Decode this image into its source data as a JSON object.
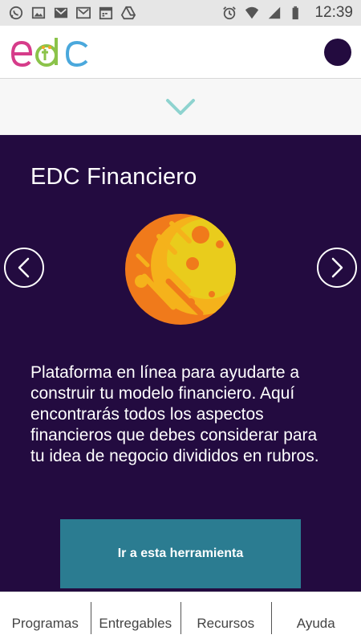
{
  "status_bar": {
    "time": "12:39",
    "left_icons": [
      "whatsapp-icon",
      "image-icon",
      "gmail-icon",
      "gmail-icon",
      "calendar-icon",
      "drive-icon"
    ],
    "right_icons": [
      "alarm-icon",
      "wifi-icon",
      "signal-icon",
      "battery-icon"
    ]
  },
  "header": {
    "logo_text": "EDC",
    "avatar_color": "#230b3f"
  },
  "collapse": {
    "icon": "chevron-down-icon",
    "color": "#8ed3cf"
  },
  "panel": {
    "background": "#230b40",
    "title": "EDC Financiero",
    "description": "Plataforma en línea para ayudarte a construir tu modelo financiero. Aquí encontrarás todos los aspectos financieros que debes considerar para tu idea de negocio divididos en rubros.",
    "cta_label": "Ir a esta herramienta",
    "cta_color": "#2b7c91",
    "prev_icon": "chevron-left-icon",
    "next_icon": "chevron-right-icon"
  },
  "bottom_nav": {
    "items": [
      {
        "label": "Programas"
      },
      {
        "label": "Entregables"
      },
      {
        "label": "Recursos"
      },
      {
        "label": "Ayuda"
      }
    ]
  }
}
